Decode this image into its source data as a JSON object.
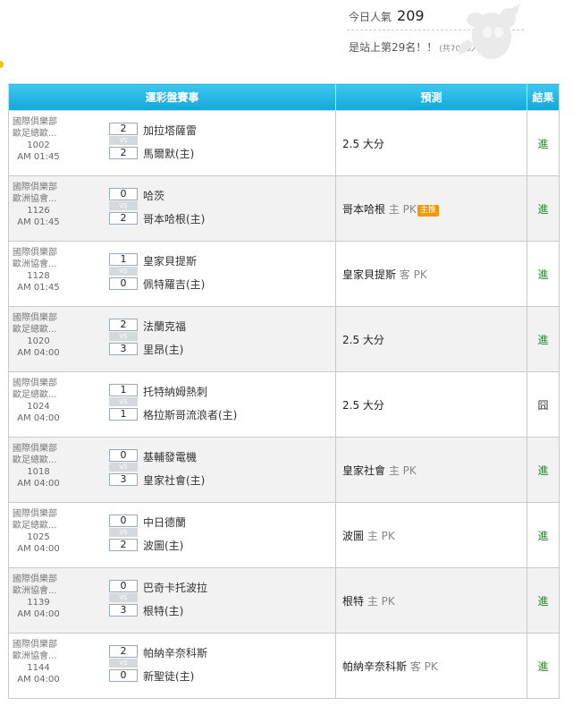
{
  "header": {
    "popularity_label": "今日人氣",
    "popularity_value": "209",
    "rank_text": "是站上第29名！！",
    "rank_sub": "(共7006人)"
  },
  "table": {
    "columns": [
      "運彩盤賽事",
      "預測",
      "結果"
    ],
    "rows": [
      {
        "league1": "國際俱樂部",
        "league2": "歐足總歐...",
        "code": "1002",
        "time": "AM 01:45",
        "team_top": "加拉塔薩雷",
        "score_top": "2",
        "vs": "VS",
        "team_bot": "馬爾默(主)",
        "score_bot": "2",
        "pred_main": "2.5 大分",
        "pred_side": "",
        "pred_tag": "",
        "result": "進",
        "result_type": "win"
      },
      {
        "league1": "國際俱樂部",
        "league2": "歐洲協會...",
        "code": "1126",
        "time": "AM 01:45",
        "team_top": "哈茨",
        "score_top": "0",
        "vs": "VS",
        "team_bot": "哥本哈根(主)",
        "score_bot": "2",
        "pred_main": "哥本哈根",
        "pred_side": "主 PK",
        "pred_tag": "主推",
        "result": "進",
        "result_type": "win"
      },
      {
        "league1": "國際俱樂部",
        "league2": "歐洲協會...",
        "code": "1128",
        "time": "AM 01:45",
        "team_top": "皇家貝提斯",
        "score_top": "1",
        "vs": "VS",
        "team_bot": "佩特羅吉(主)",
        "score_bot": "0",
        "pred_main": "皇家貝提斯",
        "pred_side": "客 PK",
        "pred_tag": "",
        "result": "進",
        "result_type": "win"
      },
      {
        "league1": "國際俱樂部",
        "league2": "歐足總歐...",
        "code": "1020",
        "time": "AM 04:00",
        "team_top": "法蘭克福",
        "score_top": "2",
        "vs": "VS",
        "team_bot": "里昂(主)",
        "score_bot": "3",
        "pred_main": "2.5 大分",
        "pred_side": "",
        "pred_tag": "",
        "result": "進",
        "result_type": "win"
      },
      {
        "league1": "國際俱樂部",
        "league2": "歐足總歐...",
        "code": "1024",
        "time": "AM 04:00",
        "team_top": "托特納姆熱刺",
        "score_top": "1",
        "vs": "VS",
        "team_bot": "格拉斯哥流浪者(主)",
        "score_bot": "1",
        "pred_main": "2.5 大分",
        "pred_side": "",
        "pred_tag": "",
        "result": "囧",
        "result_type": "push"
      },
      {
        "league1": "國際俱樂部",
        "league2": "歐足總歐...",
        "code": "1018",
        "time": "AM 04:00",
        "team_top": "基輔發電機",
        "score_top": "0",
        "vs": "VS",
        "team_bot": "皇家社會(主)",
        "score_bot": "3",
        "pred_main": "皇家社會",
        "pred_side": "主 PK",
        "pred_tag": "",
        "result": "進",
        "result_type": "win"
      },
      {
        "league1": "國際俱樂部",
        "league2": "歐足總歐...",
        "code": "1025",
        "time": "AM 04:00",
        "team_top": "中日德蘭",
        "score_top": "0",
        "vs": "VS",
        "team_bot": "波圖(主)",
        "score_bot": "2",
        "pred_main": "波圖",
        "pred_side": "主 PK",
        "pred_tag": "",
        "result": "進",
        "result_type": "win"
      },
      {
        "league1": "國際俱樂部",
        "league2": "歐洲協會...",
        "code": "1139",
        "time": "AM 04:00",
        "team_top": "巴奇卡托波拉",
        "score_top": "0",
        "vs": "VS",
        "team_bot": "根特(主)",
        "score_bot": "3",
        "pred_main": "根特",
        "pred_side": "主 PK",
        "pred_tag": "",
        "result": "進",
        "result_type": "win"
      },
      {
        "league1": "國際俱樂部",
        "league2": "歐洲協會...",
        "code": "1144",
        "time": "AM 04:00",
        "team_top": "帕納辛奈科斯",
        "score_top": "2",
        "vs": "VS",
        "team_bot": "新聖徒(主)",
        "score_bot": "0",
        "pred_main": "帕納辛奈科斯",
        "pred_side": "客 PK",
        "pred_tag": "",
        "result": "進",
        "result_type": "win"
      }
    ]
  }
}
